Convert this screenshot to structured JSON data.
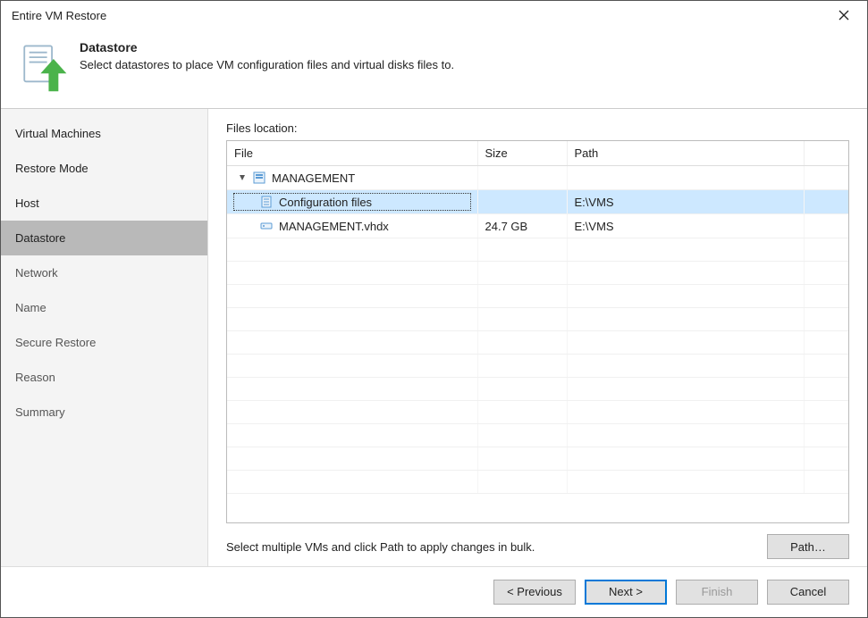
{
  "window": {
    "title": "Entire VM Restore"
  },
  "header": {
    "heading": "Datastore",
    "subtitle": "Select datastores to place VM configuration files and virtual disks files to."
  },
  "sidebar": {
    "steps": [
      {
        "label": "Virtual Machines",
        "state": "done"
      },
      {
        "label": "Restore Mode",
        "state": "done"
      },
      {
        "label": "Host",
        "state": "done"
      },
      {
        "label": "Datastore",
        "state": "active"
      },
      {
        "label": "Network",
        "state": "pending"
      },
      {
        "label": "Name",
        "state": "pending"
      },
      {
        "label": "Secure Restore",
        "state": "pending"
      },
      {
        "label": "Reason",
        "state": "pending"
      },
      {
        "label": "Summary",
        "state": "pending"
      }
    ]
  },
  "main": {
    "files_location_label": "Files location:",
    "columns": {
      "file": "File",
      "size": "Size",
      "path": "Path"
    },
    "rows": [
      {
        "kind": "vm",
        "file": "MANAGEMENT",
        "size": "",
        "path": "",
        "expanded": true
      },
      {
        "kind": "cfg",
        "file": "Configuration files",
        "size": "",
        "path": "E:\\VMS",
        "selected": true
      },
      {
        "kind": "disk",
        "file": "MANAGEMENT.vhdx",
        "size": "24.7 GB",
        "path": "E:\\VMS"
      }
    ],
    "hint": "Select multiple VMs and click Path to apply changes in bulk.",
    "path_button": "Path…"
  },
  "footer": {
    "previous": "< Previous",
    "next": "Next >",
    "finish": "Finish",
    "cancel": "Cancel"
  }
}
